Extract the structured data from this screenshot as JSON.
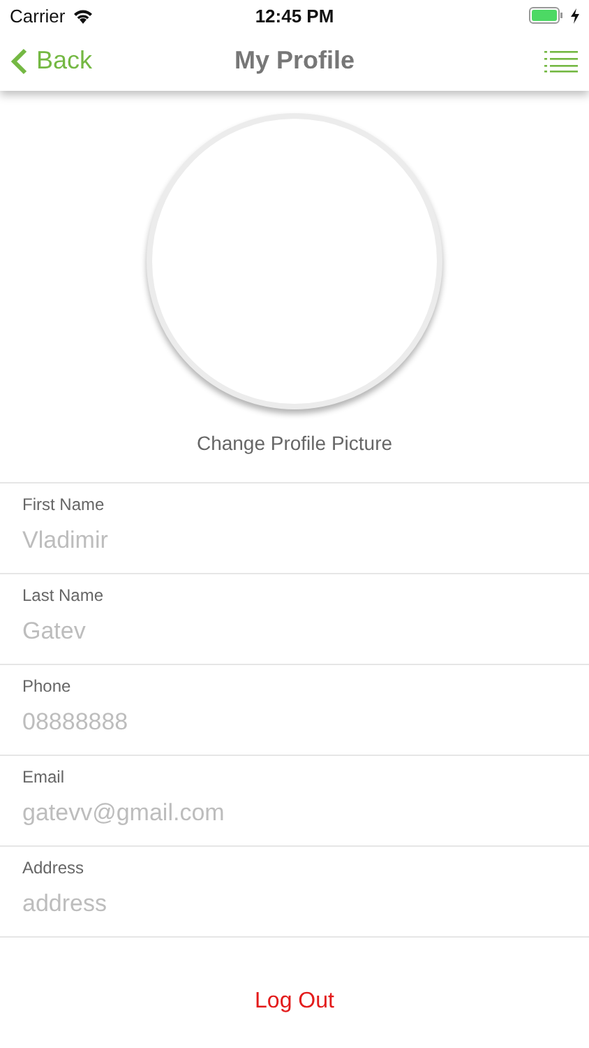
{
  "status_bar": {
    "carrier": "Carrier",
    "time": "12:45 PM",
    "charging": true
  },
  "nav_bar": {
    "back": "Back",
    "title": "My Profile"
  },
  "avatar": {
    "caption": "Change Profile Picture"
  },
  "fields": [
    {
      "label": "First Name",
      "value": "Vladimir"
    },
    {
      "label": "Last Name",
      "value": "Gatev"
    },
    {
      "label": "Phone",
      "value": "08888888"
    },
    {
      "label": "Email",
      "value": "gatevv@gmail.com"
    },
    {
      "label": "Address",
      "placeholder": "address"
    }
  ],
  "logout": "Log Out"
}
